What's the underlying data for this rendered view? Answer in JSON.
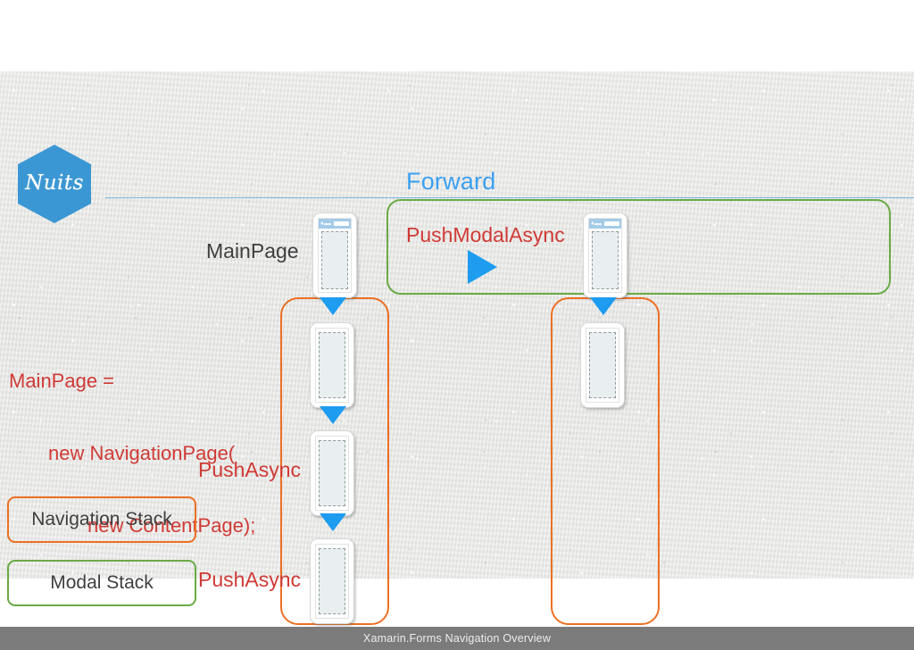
{
  "slide": {
    "title": "Forward",
    "footer_text": "Xamarin.Forms Navigation Overview",
    "logo_text": "Nuits"
  },
  "labels": {
    "main_page": "MainPage",
    "push_modal_async": "PushModalAsync",
    "push_async_1": "PushAsync",
    "push_async_2": "PushAsync"
  },
  "code": {
    "line1": "MainPage =",
    "line2": "new NavigationPage(",
    "line3": "new ContentPage);"
  },
  "legend": {
    "navigation_stack": "Navigation Stack",
    "modal_stack": "Modal Stack"
  },
  "colors": {
    "title_blue": "#3ba0f0",
    "arrow_blue": "#1e9cf0",
    "nav_stack_orange": "#ec7024",
    "modal_stack_green": "#6aab46",
    "code_red": "#cf3b36",
    "label_dark": "#3f3f3f",
    "footer_gray": "#7b7b7b",
    "logo_blue": "#3b97d3",
    "paper_gray": "#e9e9e7"
  },
  "icons": {
    "play": "play-triangle-icon",
    "arrow": "arrow-down-icon",
    "back": "back-chevron-icon"
  }
}
